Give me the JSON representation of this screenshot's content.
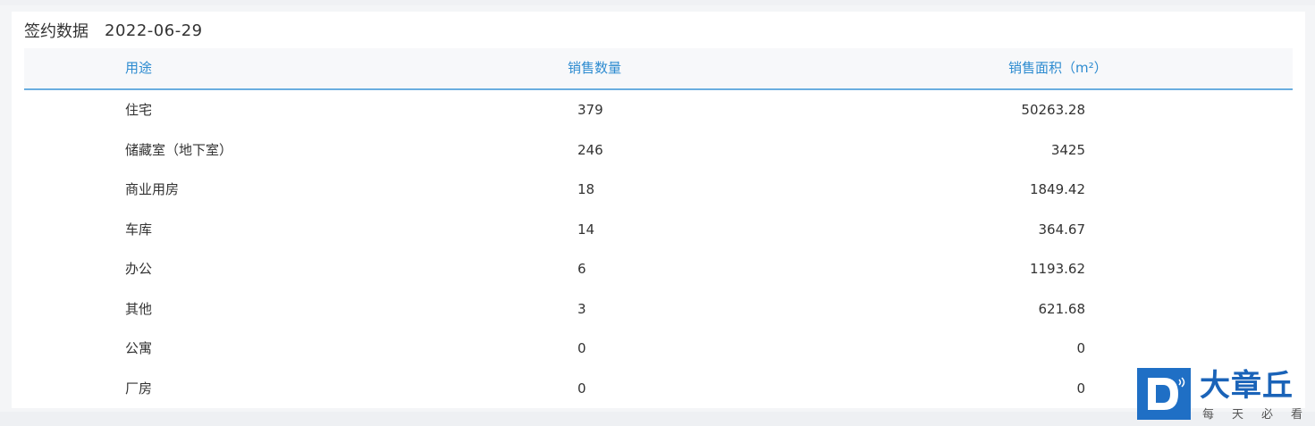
{
  "title": {
    "label": "签约数据",
    "date": "2022-06-29"
  },
  "table": {
    "headers": {
      "use": "用途",
      "count": "销售数量",
      "area": "销售面积（m²）"
    },
    "rows": [
      {
        "use": "住宅",
        "count": "379",
        "area": "50263.28"
      },
      {
        "use": "储藏室（地下室）",
        "count": "246",
        "area": "3425"
      },
      {
        "use": "商业用房",
        "count": "18",
        "area": "1849.42"
      },
      {
        "use": "车库",
        "count": "14",
        "area": "364.67"
      },
      {
        "use": "办公",
        "count": "6",
        "area": "1193.62"
      },
      {
        "use": "其他",
        "count": "3",
        "area": "621.68"
      },
      {
        "use": "公寓",
        "count": "0",
        "area": "0"
      },
      {
        "use": "厂房",
        "count": "0",
        "area": "0"
      }
    ]
  },
  "watermark": {
    "brand": "大章丘",
    "slogan": "每天必看"
  },
  "colors": {
    "header_text": "#2d8bd0",
    "header_border": "#6aaee0",
    "logo_blue": "#1f6fc5"
  }
}
